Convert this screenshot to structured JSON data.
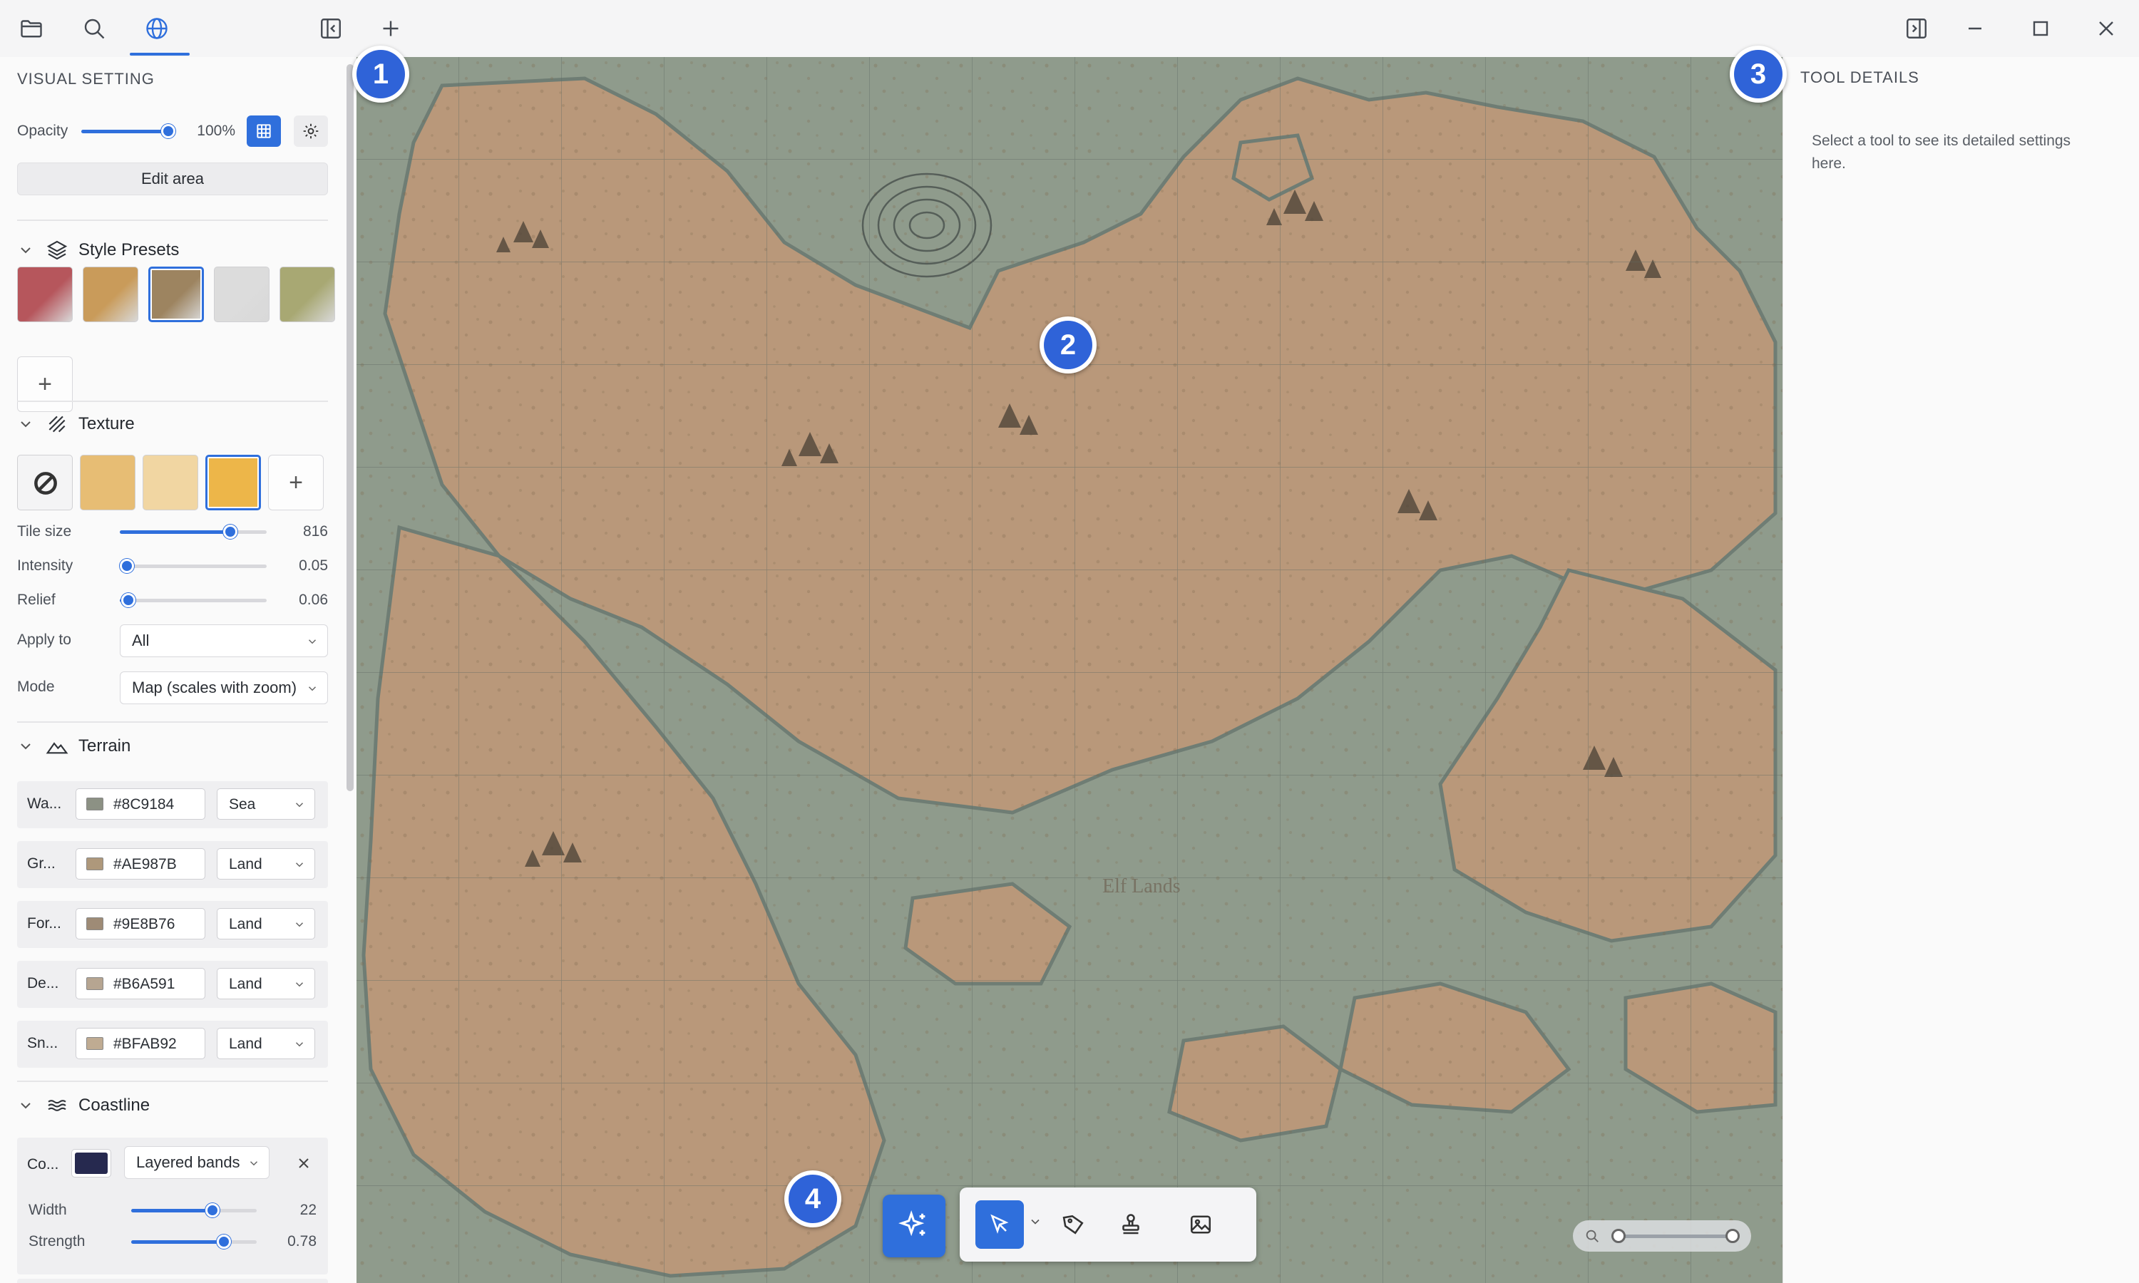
{
  "colors": {
    "accent": "#2f6fdc",
    "marker": "#2f63d8",
    "coastline": "#26294f"
  },
  "toolbar_top": {
    "icons": [
      "folder-icon",
      "search-icon",
      "globe-icon",
      "collapse-panel-icon",
      "plus-icon",
      "right-panel-icon",
      "minimize-icon",
      "maximize-icon",
      "close-icon"
    ]
  },
  "visual_setting": {
    "title": "VISUAL SETTING",
    "opacity_label": "Opacity",
    "opacity_value": "100%",
    "opacity_fraction": 1.0,
    "edit_area_label": "Edit area"
  },
  "style_presets": {
    "title": "Style Presets",
    "presets": [
      {
        "color": "#b6565c",
        "selected": false
      },
      {
        "color": "#c99b5a",
        "selected": false
      },
      {
        "color": "#9d8460",
        "selected": true
      },
      {
        "color": "#dcdcdc",
        "selected": false
      },
      {
        "color": "#a8a873",
        "selected": false
      }
    ],
    "add_label": "+"
  },
  "texture": {
    "title": "Texture",
    "tiles": [
      {
        "type": "none",
        "selected": false
      },
      {
        "color": "#e7bd74",
        "selected": false
      },
      {
        "color": "#f1d6a2",
        "selected": false
      },
      {
        "color": "#edb649",
        "selected": true
      }
    ],
    "add_label": "+",
    "tile_size": {
      "label": "Tile size",
      "value": "816",
      "fraction": 0.75
    },
    "intensity": {
      "label": "Intensity",
      "value": "0.05",
      "fraction": 0.05
    },
    "relief": {
      "label": "Relief",
      "value": "0.06",
      "fraction": 0.06
    },
    "apply_to": {
      "label": "Apply to",
      "value": "All"
    },
    "mode": {
      "label": "Mode",
      "value": "Map (scales with zoom)"
    }
  },
  "terrain": {
    "title": "Terrain",
    "rows": [
      {
        "name": "Wa...",
        "hex": "#8C9184",
        "type": "Sea"
      },
      {
        "name": "Gr...",
        "hex": "#AE987B",
        "type": "Land"
      },
      {
        "name": "For...",
        "hex": "#9E8B76",
        "type": "Land"
      },
      {
        "name": "De...",
        "hex": "#B6A591",
        "type": "Land"
      },
      {
        "name": "Sn...",
        "hex": "#BFAB92",
        "type": "Land"
      }
    ]
  },
  "coastline": {
    "title": "Coastline",
    "color_label": "Co...",
    "style": "Layered bands",
    "width": {
      "label": "Width",
      "value": "22",
      "fraction": 0.65
    },
    "strength": {
      "label": "Strength",
      "value": "0.78",
      "fraction": 0.74
    }
  },
  "tool_details": {
    "title": "TOOL DETAILS",
    "hint": "Select a tool to see its detailed settings here."
  },
  "map_labels": [
    "Elf Lands"
  ],
  "markers": [
    "1",
    "2",
    "3",
    "4"
  ],
  "bottom_tools": [
    "ai-sparkle-icon",
    "select-arrow-icon",
    "tag-icon",
    "stamp-icon",
    "image-icon"
  ],
  "zoom": {
    "fraction": 0.0
  }
}
